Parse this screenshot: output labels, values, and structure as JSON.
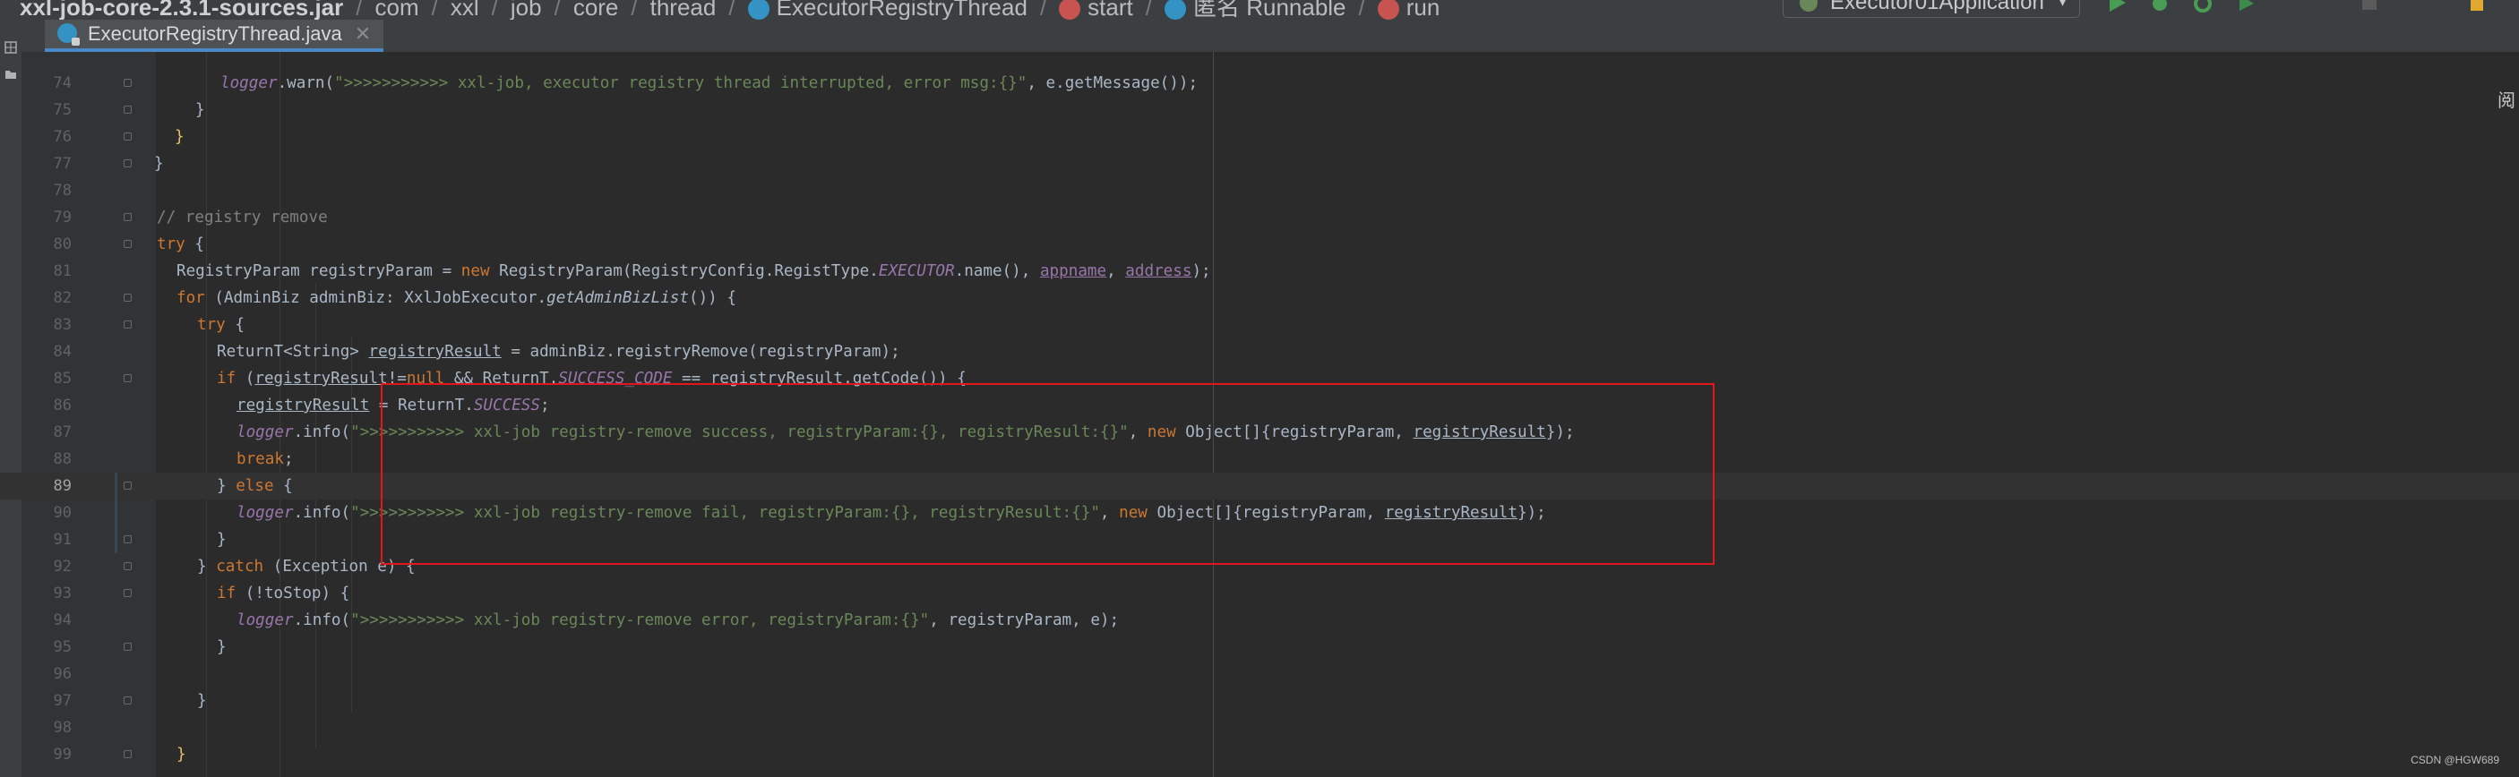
{
  "breadcrumbs": [
    {
      "label": "xxl-job-core-2.3.1-sources.jar",
      "icon": "jar-icon"
    },
    {
      "label": "com"
    },
    {
      "label": "xxl"
    },
    {
      "label": "job"
    },
    {
      "label": "core"
    },
    {
      "label": "thread"
    },
    {
      "label": "ExecutorRegistryThread",
      "icon": "class-icon"
    },
    {
      "label": "start",
      "icon": "method-icon"
    },
    {
      "label": "匿名 Runnable",
      "icon": "class-icon"
    },
    {
      "label": "run",
      "icon": "method-icon"
    }
  ],
  "run_config": {
    "label": "Executor01Application",
    "icon": "spring-boot-icon"
  },
  "toolbar": {
    "icons": [
      "run-icon",
      "debug-icon",
      "coverage-icon",
      "profile-icon",
      "stop-icon"
    ]
  },
  "tab": {
    "title": "ExecutorRegistryThread.java",
    "icon": "java-class-icon",
    "close": "✕"
  },
  "editor": {
    "current_line": 89,
    "side_label": "阅",
    "highlight_box": {
      "from_line": 85,
      "to_line": 91,
      "color": "#e3151d"
    },
    "lines": [
      {
        "n": 74,
        "tokens": [
          [
            "fld",
            "logger"
          ],
          [
            "",
            "."
          ],
          [
            "",
            "warn("
          ],
          [
            "str",
            "\">>>>>>>>>>> xxl-job, executor registry thread interrupted, error msg:{}\""
          ],
          [
            "",
            ", e.getMessage());"
          ]
        ]
      },
      {
        "n": 75,
        "tokens": [
          [
            "",
            "}"
          ]
        ]
      },
      {
        "n": 76,
        "tokens": [
          [
            "bkt",
            "}"
          ]
        ]
      },
      {
        "n": 77,
        "tokens": [
          [
            "",
            "}"
          ]
        ]
      },
      {
        "n": 78,
        "tokens": []
      },
      {
        "n": 79,
        "tokens": [
          [
            "cmt",
            "// registry remove"
          ]
        ]
      },
      {
        "n": 80,
        "tokens": [
          [
            "kw",
            "try"
          ],
          [
            "",
            " {"
          ]
        ]
      },
      {
        "n": 81,
        "tokens": [
          [
            "",
            "RegistryParam registryParam = "
          ],
          [
            "kw",
            "new"
          ],
          [
            "",
            " RegistryParam(RegistryConfig.RegistType."
          ],
          [
            "fld",
            "EXECUTOR"
          ],
          [
            "",
            ".name(), "
          ],
          [
            "fldu",
            "appname"
          ],
          [
            "",
            ", "
          ],
          [
            "fldu",
            "address"
          ],
          [
            "",
            ");"
          ]
        ]
      },
      {
        "n": 82,
        "tokens": [
          [
            "kw",
            "for"
          ],
          [
            "",
            " (AdminBiz adminBiz: XxlJobExecutor."
          ],
          [
            "stc",
            "getAdminBizList"
          ],
          [
            "",
            "()) {"
          ]
        ]
      },
      {
        "n": 83,
        "tokens": [
          [
            "kw",
            "try"
          ],
          [
            "",
            " {"
          ]
        ]
      },
      {
        "n": 84,
        "tokens": [
          [
            "",
            "ReturnT<String> "
          ],
          [
            "ul",
            "registryResult"
          ],
          [
            "",
            " = adminBiz.registryRemove(registryParam);"
          ]
        ]
      },
      {
        "n": 85,
        "tokens": [
          [
            "kw",
            "if"
          ],
          [
            "",
            " ("
          ],
          [
            "ul",
            "registryResult"
          ],
          [
            "",
            "!="
          ],
          [
            "kw",
            "null"
          ],
          [
            "",
            " && ReturnT."
          ],
          [
            "fld",
            "SUCCESS_CODE"
          ],
          [
            "",
            " == "
          ],
          [
            "ul",
            "registryResult"
          ],
          [
            "",
            ".getCode()) {"
          ]
        ]
      },
      {
        "n": 86,
        "tokens": [
          [
            "ul",
            "registryResult"
          ],
          [
            "",
            " = ReturnT."
          ],
          [
            "fld",
            "SUCCESS"
          ],
          [
            "",
            ";"
          ]
        ]
      },
      {
        "n": 87,
        "tokens": [
          [
            "fld",
            "logger"
          ],
          [
            "",
            ".info("
          ],
          [
            "str",
            "\">>>>>>>>>>> xxl-job registry-remove success, registryParam:{}, registryResult:{}\""
          ],
          [
            "",
            ", "
          ],
          [
            "kw",
            "new"
          ],
          [
            "",
            " Object[]{registryParam, "
          ],
          [
            "ul",
            "registryResult"
          ],
          [
            "",
            "});"
          ]
        ]
      },
      {
        "n": 88,
        "tokens": [
          [
            "kw",
            "break"
          ],
          [
            "",
            ";"
          ]
        ]
      },
      {
        "n": 89,
        "tokens": [
          [
            "",
            "} "
          ],
          [
            "kw",
            "else"
          ],
          [
            "",
            " {"
          ]
        ]
      },
      {
        "n": 90,
        "tokens": [
          [
            "fld",
            "logger"
          ],
          [
            "",
            ".info("
          ],
          [
            "str",
            "\">>>>>>>>>>> xxl-job registry-remove fail, registryParam:{}, registryResult:{}\""
          ],
          [
            "",
            ", "
          ],
          [
            "kw",
            "new"
          ],
          [
            "",
            " Object[]{registryParam, "
          ],
          [
            "ul",
            "registryResult"
          ],
          [
            "",
            "});"
          ]
        ]
      },
      {
        "n": 91,
        "tokens": [
          [
            "",
            "}"
          ]
        ]
      },
      {
        "n": 92,
        "tokens": [
          [
            "",
            "} "
          ],
          [
            "kw",
            "catch"
          ],
          [
            "",
            " (Exception e) {"
          ]
        ]
      },
      {
        "n": 93,
        "tokens": [
          [
            "kw",
            "if"
          ],
          [
            "",
            " (!toStop) {"
          ]
        ]
      },
      {
        "n": 94,
        "tokens": [
          [
            "fld",
            "logger"
          ],
          [
            "",
            ".info("
          ],
          [
            "str",
            "\">>>>>>>>>>> xxl-job registry-remove error, registryParam:{}\""
          ],
          [
            "",
            ", registryParam, e);"
          ]
        ]
      },
      {
        "n": 95,
        "tokens": [
          [
            "",
            "}"
          ]
        ]
      },
      {
        "n": 96,
        "tokens": []
      },
      {
        "n": 97,
        "tokens": [
          [
            "",
            "}"
          ]
        ]
      },
      {
        "n": 98,
        "tokens": []
      },
      {
        "n": 99,
        "tokens": [
          [
            "bkt",
            "}"
          ]
        ]
      }
    ]
  },
  "watermark": "CSDN @HGW689",
  "colors": {
    "keyword": "#cc7832",
    "string": "#6a8759",
    "comment": "#808080",
    "field": "#9876aa",
    "text": "#a9b7c6",
    "background": "#2b2b2b"
  }
}
